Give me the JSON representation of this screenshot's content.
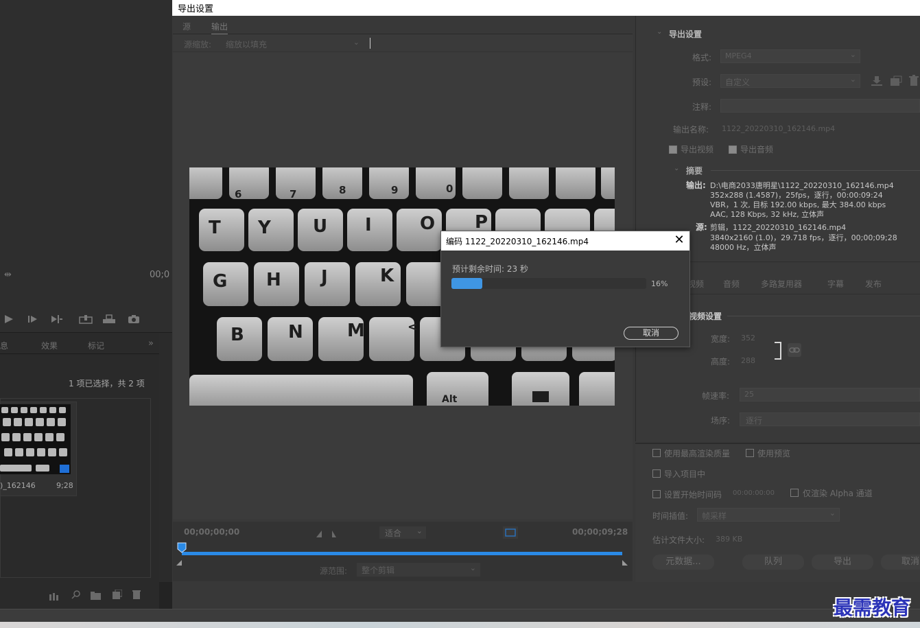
{
  "window": {
    "title": "导出设置"
  },
  "source_tabs": [
    {
      "label": "源"
    },
    {
      "label": "输出"
    }
  ],
  "source_scaling": {
    "label": "源缩放:",
    "value": "缩放以填充"
  },
  "export_settings": {
    "header": "导出设置",
    "format_label": "格式:",
    "format_value": "MPEG4",
    "preset_label": "预设:",
    "preset_value": "自定义",
    "comments_label": "注释:",
    "output_name_label": "输出名称:",
    "output_name_value": "1122_20220310_162146.mp4",
    "export_video_label": "导出视频",
    "export_audio_label": "导出音频"
  },
  "summary": {
    "header": "摘要",
    "output_label": "输出:",
    "output_lines": [
      "D:\\电商2033唐明星\\1122_20220310_162146.mp4",
      "352x288 (1.4587)，25fps，逐行，00:00:09:24",
      "VBR，1 次, 目标 192.00 kbps, 最大 384.00 kbps",
      "AAC, 128 Kbps, 32  kHz, 立体声"
    ],
    "source_label": "源:",
    "source_lines": [
      "剪辑，1122_20220310_162146.mp4",
      "3840x2160 (1.0)，29.718 fps，逐行，00;00;09;28",
      "48000 Hz，立体声"
    ]
  },
  "settings_tabs": [
    "视频",
    "音频",
    "多路复用器",
    "字幕",
    "发布"
  ],
  "video_settings": {
    "header": "视频设置",
    "width_label": "宽度:",
    "width_value": "352",
    "height_label": "高度:",
    "height_value": "288",
    "frame_rate_label": "帧速率:",
    "frame_rate_value": "25",
    "field_order_label": "场序:",
    "field_order_value": "逐行"
  },
  "options": {
    "max_render_quality": "使用最高渲染质量",
    "use_previews": "使用预览",
    "import_into_project": "导入项目中",
    "set_start_timecode": "设置开始时间码",
    "start_timecode_value": "00:00:00:00",
    "render_alpha_only": "仅渲染 Alpha 通道",
    "time_interpolation_label": "时间插值:",
    "time_interpolation_value": "帧采样",
    "file_size_label": "估计文件大小:",
    "file_size_value": "389 KB"
  },
  "actions": {
    "metadata": "元数据...",
    "queue": "队列",
    "export": "导出",
    "cancel": "取消"
  },
  "timeline": {
    "start_tc": "00;00;00;00",
    "fit": "适合",
    "end_tc": "00;00;09;28",
    "range_label": "源范围:",
    "range_value": "整个剪辑"
  },
  "encoding_dialog": {
    "title": "编码 1122_20220310_162146.mp4",
    "remaining": "预计剩余时间: 23 秒",
    "progress": 0.16,
    "progress_text": "16%",
    "cancel": "取消"
  },
  "project_panel": {
    "tabs": [
      "息",
      "效果",
      "标记"
    ],
    "selection_status": "1 项已选择，共 2 项",
    "clip_name": ")_162146",
    "clip_duration": "9;28"
  },
  "program_timecode": "00;0",
  "watermark": "最需教育",
  "colors": {
    "progress_fill": "#3f96e4",
    "playhead": "#2a8ae6",
    "watermark": "#2b33b8"
  }
}
